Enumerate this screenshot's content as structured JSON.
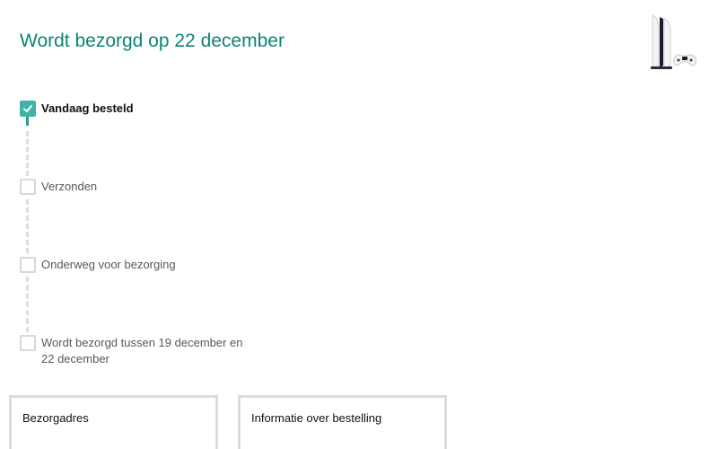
{
  "header": {
    "title": "Wordt bezorgd op 22 december"
  },
  "product": {
    "image_icon": "console-product-image-icon"
  },
  "tracker": {
    "steps": [
      {
        "label": "Vandaag besteld",
        "status": "done"
      },
      {
        "label": "Verzonden",
        "status": "pending"
      },
      {
        "label": "Onderweg voor bezorging",
        "status": "pending"
      },
      {
        "label": "Wordt bezorgd tussen 19 december en 22 december",
        "status": "pending"
      }
    ]
  },
  "cards": {
    "address_title": "Bezorgadres",
    "order_info_title": "Informatie over bestelling"
  },
  "colors": {
    "accent": "#0c8475",
    "check": "#3fb3a6",
    "inactive": "#d8d8d8"
  }
}
